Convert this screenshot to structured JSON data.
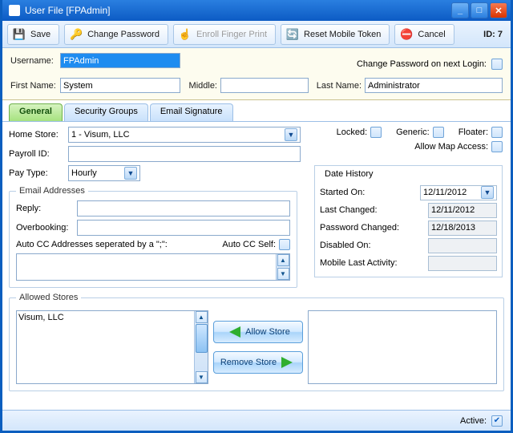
{
  "window": {
    "title": "User File [FPAdmin]"
  },
  "toolbar": {
    "save": "Save",
    "change_password": "Change Password",
    "enroll_fingerprint": "Enroll Finger Print",
    "reset_mobile": "Reset Mobile Token",
    "cancel": "Cancel",
    "id_label": "ID: 7"
  },
  "header": {
    "username_label": "Username:",
    "username": "FPAdmin",
    "firstname_label": "First Name:",
    "firstname": "System",
    "middle_label": "Middle:",
    "middle": "",
    "lastname_label": "Last Name:",
    "lastname": "Administrator",
    "change_on_next_label": "Change Password on next Login:"
  },
  "tabs": {
    "general": "General",
    "security_groups": "Security Groups",
    "email_signature": "Email Signature"
  },
  "general": {
    "home_store_label": "Home Store:",
    "home_store": "1 - Visum, LLC",
    "payroll_id_label": "Payroll ID:",
    "payroll_id": "",
    "pay_type_label": "Pay Type:",
    "pay_type": "Hourly",
    "locked_label": "Locked:",
    "generic_label": "Generic:",
    "floater_label": "Floater:",
    "allow_map_label": "Allow Map Access:",
    "email_box_legend": "Email Addresses",
    "reply_label": "Reply:",
    "reply": "",
    "overbooking_label": "Overbooking:",
    "overbooking": "",
    "autocc_label": "Auto CC Addresses seperated by a \";\":",
    "autocc_self_label": "Auto CC Self:",
    "date_history_label": "Date History",
    "started_on_label": "Started On:",
    "started_on": "12/11/2012",
    "last_changed_label": "Last Changed:",
    "last_changed": "12/11/2012",
    "pwd_changed_label": "Password Changed:",
    "pwd_changed": "12/18/2013",
    "disabled_on_label": "Disabled On:",
    "disabled_on": "",
    "mobile_last_label": "Mobile Last Activity:",
    "mobile_last": "",
    "allowed_legend": "Allowed Stores",
    "allowed_item_0": "Visum, LLC",
    "allow_store_btn": "Allow Store",
    "remove_store_btn": "Remove Store"
  },
  "footer": {
    "active_label": "Active:"
  }
}
